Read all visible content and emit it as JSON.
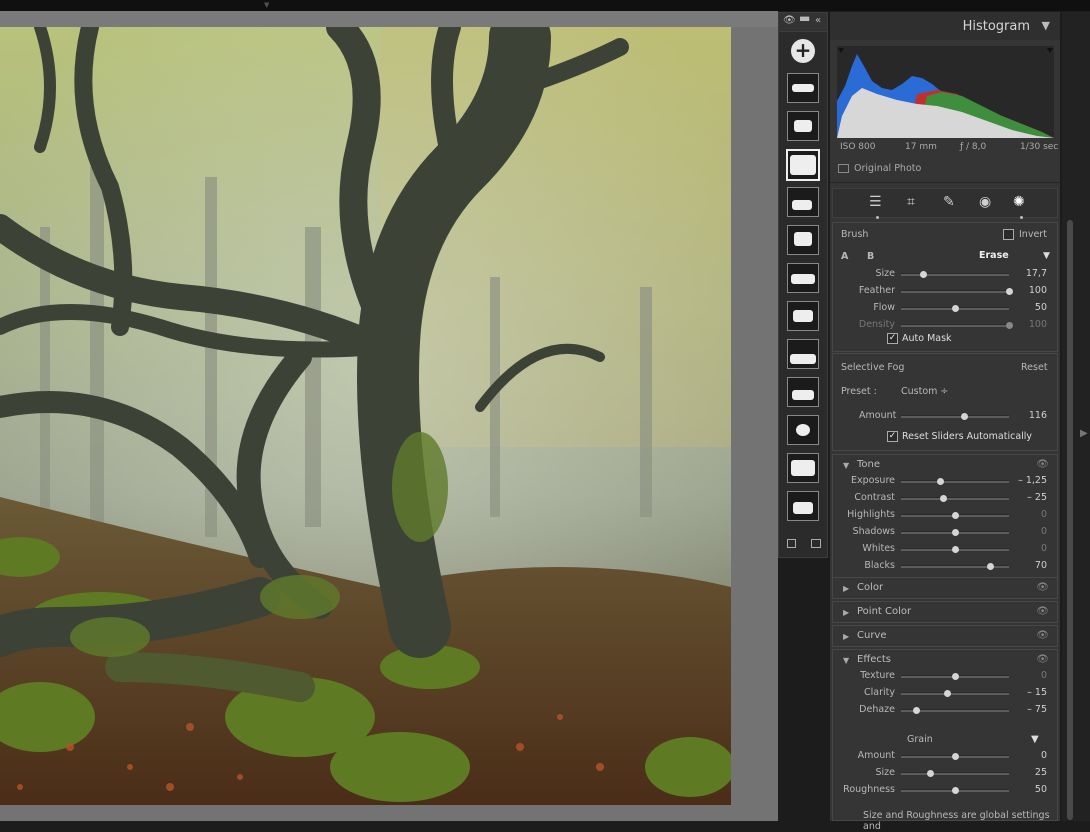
{
  "window": {
    "grip_icon": "drag-handle-icon"
  },
  "mask_strip": {
    "add_button_label": "+",
    "icons": [
      "eye-icon",
      "minimize-icon",
      "collapse-icon"
    ],
    "thumbnail_count": 12,
    "selected_index": 2
  },
  "histogram": {
    "title": "Histogram",
    "iso": "ISO 800",
    "focal_length": "17 mm",
    "aperture": "ƒ / 8,0",
    "shutter": "1/30 sec",
    "original_photo_label": "Original Photo"
  },
  "tools": [
    "edit-sliders-icon",
    "crop-icon",
    "healing-icon",
    "red-eye-icon",
    "masking-icon"
  ],
  "brush": {
    "title": "Brush",
    "invert_label": "Invert",
    "brush_a": "A",
    "brush_b": "B",
    "erase_label": "Erase",
    "sliders": [
      {
        "label": "Size",
        "value": "17,7",
        "pos": 0.2
      },
      {
        "label": "Feather",
        "value": "100",
        "pos": 1.0
      },
      {
        "label": "Flow",
        "value": "50",
        "pos": 0.5
      },
      {
        "label": "Density",
        "value": "100",
        "pos": 1.0,
        "disabled": true
      }
    ],
    "auto_mask_label": "Auto Mask"
  },
  "selective": {
    "title": "Selective Fog",
    "reset_label": "Reset",
    "preset_label": "Preset :",
    "preset_value": "Custom ÷",
    "amount_label": "Amount",
    "amount_value": "116",
    "amount_pos": 0.58,
    "reset_sliders_label": "Reset Sliders Automatically"
  },
  "tone": {
    "title": "Tone",
    "sliders": [
      {
        "label": "Exposure",
        "value": "– 1,25",
        "pos": 0.36
      },
      {
        "label": "Contrast",
        "value": "– 25",
        "pos": 0.39
      },
      {
        "label": "Highlights",
        "value": "0",
        "pos": 0.5,
        "dim": true
      },
      {
        "label": "Shadows",
        "value": "0",
        "pos": 0.5,
        "dim": true
      },
      {
        "label": "Whites",
        "value": "0",
        "pos": 0.5,
        "dim": true
      },
      {
        "label": "Blacks",
        "value": "70",
        "pos": 0.82
      }
    ]
  },
  "collapsed": [
    "Color",
    "Point Color",
    "Curve"
  ],
  "effects": {
    "title": "Effects",
    "sliders": [
      {
        "label": "Texture",
        "value": "0",
        "pos": 0.5,
        "dim": true
      },
      {
        "label": "Clarity",
        "value": "– 15",
        "pos": 0.43
      },
      {
        "label": "Dehaze",
        "value": "– 75",
        "pos": 0.14
      }
    ],
    "grain_title": "Grain",
    "grain_sliders": [
      {
        "label": "Amount",
        "value": "0",
        "pos": 0.5
      },
      {
        "label": "Size",
        "value": "25",
        "pos": 0.27
      },
      {
        "label": "Roughness",
        "value": "50",
        "pos": 0.5
      }
    ],
    "note": "Size and Roughness are global settings and"
  }
}
